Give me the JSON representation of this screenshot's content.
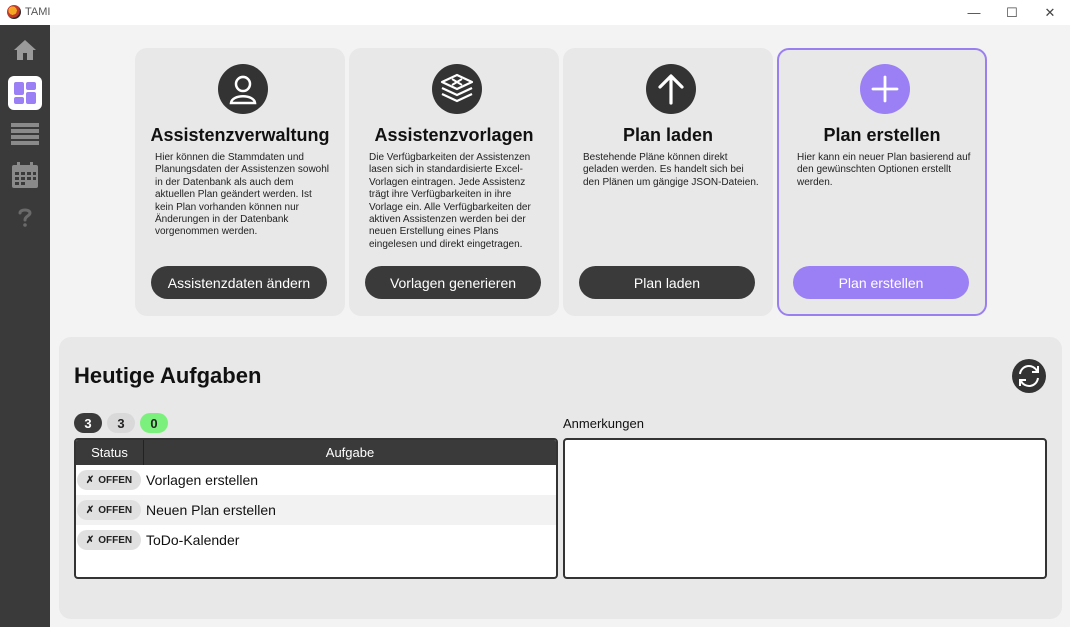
{
  "window": {
    "title": "TAMI",
    "controls": {
      "minimize": "—",
      "maximize": "☐",
      "close": "✕"
    }
  },
  "sidebar": {
    "items": [
      {
        "name": "home",
        "icon": "home-icon",
        "active": false
      },
      {
        "name": "dashboard",
        "icon": "dashboard-icon",
        "active": true
      },
      {
        "name": "list",
        "icon": "list-icon",
        "active": false
      },
      {
        "name": "calendar",
        "icon": "calendar-icon",
        "active": false
      },
      {
        "name": "help",
        "icon": "help-icon",
        "active": false
      }
    ]
  },
  "cards": [
    {
      "icon": "user-icon",
      "title": "Assistenzverwaltung",
      "description": "Hier können die Stammdaten und Planungsdaten der Assistenzen sowohl in der Datenbank als auch dem aktuellen Plan geändert werden. Ist kein Plan vorhanden können nur Änderungen in der Datenbank vorgenommen werden.",
      "button": "Assistenzdaten ändern"
    },
    {
      "icon": "layers-icon",
      "title": "Assistenzvorlagen",
      "description": "Die Verfügbarkeiten der Assistenzen lasen sich in standardisierte Excel-Vorlagen eintragen. Jede Assistenz trägt ihre Verfügbarkeiten in ihre Vorlage ein. Alle Verfügbarkeiten der aktiven Assistenzen werden bei der neuen Erstellung eines Plans eingelesen und direkt eingetragen.",
      "button": "Vorlagen generieren"
    },
    {
      "icon": "arrow-up-icon",
      "title": "Plan laden",
      "description": "Bestehende Pläne können direkt geladen werden. Es handelt sich bei den Plänen um gängige JSON-Dateien.",
      "button": "Plan laden"
    },
    {
      "icon": "plus-icon",
      "title": "Plan erstellen",
      "description": "Hier kann ein neuer Plan basierend auf den gewünschten Optionen erstellt werden.",
      "button": "Plan erstellen"
    }
  ],
  "tasks_panel": {
    "title": "Heutige Aufgaben",
    "refresh_icon": "refresh-icon",
    "counts": [
      "3",
      "3",
      "0"
    ],
    "columns": {
      "status": "Status",
      "task": "Aufgabe"
    },
    "rows": [
      {
        "status": "OFFEN",
        "status_mark": "✗",
        "task": "Vorlagen erstellen"
      },
      {
        "status": "OFFEN",
        "status_mark": "✗",
        "task": "Neuen Plan erstellen"
      },
      {
        "status": "OFFEN",
        "status_mark": "✗",
        "task": "ToDo-Kalender"
      }
    ],
    "notes_label": "Anmerkungen",
    "notes_value": ""
  },
  "colors": {
    "accent": "#9b7ff5",
    "dark": "#3a3a3a",
    "count_green": "#7cf07c"
  }
}
